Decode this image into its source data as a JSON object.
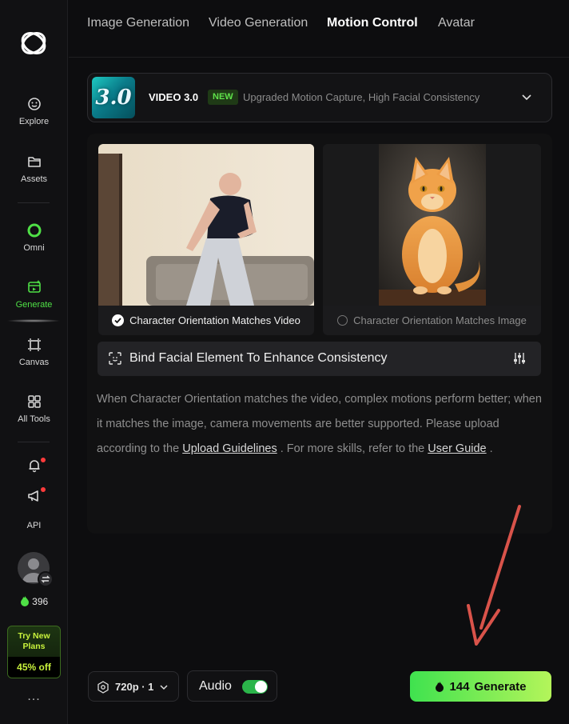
{
  "sidebar": {
    "items": [
      {
        "label": "Explore",
        "icon": "compass-smile-icon"
      },
      {
        "label": "Assets",
        "icon": "folder-icon"
      },
      {
        "label": "Omni",
        "icon": "omni-ring-icon"
      },
      {
        "label": "Generate",
        "icon": "generate-icon",
        "active": true
      },
      {
        "label": "Canvas",
        "icon": "canvas-icon"
      },
      {
        "label": "All Tools",
        "icon": "grid-icon"
      },
      {
        "label": "",
        "icon": "bell-icon"
      },
      {
        "label": "",
        "icon": "megaphone-icon"
      },
      {
        "label": "API",
        "icon": ""
      }
    ],
    "credits": "396",
    "promo": {
      "line1": "Try New Plans",
      "line2": "45% off"
    },
    "more": "..."
  },
  "tabs": [
    {
      "label": "Image Generation"
    },
    {
      "label": "Video Generation"
    },
    {
      "label": "Motion Control",
      "active": true
    },
    {
      "label": "Avatar"
    }
  ],
  "model": {
    "thumb_text": "3.0",
    "name": "VIDEO 3.0",
    "badge": "NEW",
    "description": "Upgraded Motion Capture, High Facial Consistency"
  },
  "cards": {
    "video": {
      "caption": "Character Orientation Matches Video",
      "selected": true
    },
    "image": {
      "caption": "Character Orientation Matches Image",
      "selected": false
    }
  },
  "bind_facial": {
    "label": "Bind Facial Element To Enhance Consistency"
  },
  "help": {
    "text1": "When Character Orientation matches the video, complex motions perform better; when it matches the image, camera movements are better supported. Please upload according to the ",
    "link1": "Upload Guidelines",
    "text2": " . For more skills, refer to the ",
    "link2": "User Guide",
    "text3": " ."
  },
  "bottom": {
    "resolution": "720p · 1",
    "audio_label": "Audio",
    "audio_on": true,
    "generate_cost": "144",
    "generate_label": "Generate"
  },
  "colors": {
    "accent_green": "#4fe046",
    "generate_gradient_start": "#3fe24f",
    "generate_gradient_end": "#b4f55a",
    "annotation_arrow": "#d9534a"
  }
}
